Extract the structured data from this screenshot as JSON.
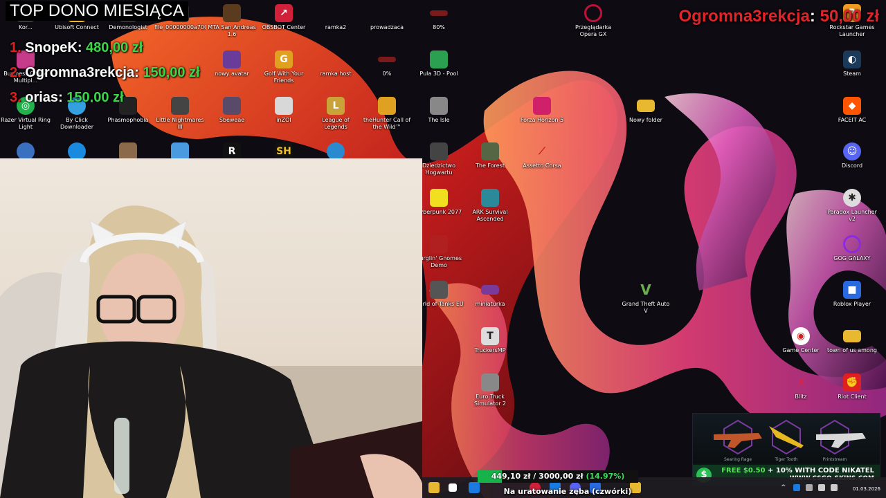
{
  "colors": {
    "accent_red": "#e0242a",
    "amount_green": "#3bd64a",
    "goal_green": "#16b24a"
  },
  "overlay": {
    "top_donors_title": "TOP DONO MIESIĄCA",
    "donors": [
      {
        "rank": "1.",
        "name": "SnopeK",
        "amount": "480,00 zł"
      },
      {
        "rank": "2.",
        "name": "Ogromna3rekcja",
        "amount": "150,00 zł"
      },
      {
        "rank": "3.",
        "name": "orias",
        "amount": "150,00 zł"
      }
    ],
    "top_donor": {
      "name": "Ogromna3rekcja",
      "separator": ":",
      "amount": "50,00 zł"
    }
  },
  "desktop_icons": [
    {
      "label": "Kor...",
      "icon": "app-icon",
      "color": "#3a3a3a"
    },
    {
      "label": "Ubisoft Connect",
      "icon": "folder-icon",
      "color": "#e8b930"
    },
    {
      "label": "Demonologist",
      "icon": "app-icon",
      "color": "#333"
    },
    {
      "label": "file_00000000a700...",
      "icon": "file-icon",
      "color": "#2a2a2a"
    },
    {
      "label": "MTA San Andreas 1.6",
      "icon": "game-icon",
      "color": "#5a3b1d"
    },
    {
      "label": "OBSBOT Center",
      "icon": "camera-icon",
      "color": "#d0203a"
    },
    {
      "label": "ramka2",
      "icon": "file-icon",
      "color": "#1c1c1c"
    },
    {
      "label": "prowadzaca",
      "icon": "file-icon",
      "color": "#1c1c1c"
    },
    {
      "label": "80%",
      "icon": "file-icon",
      "color": "#7a1a1a"
    },
    {
      "label": "Przeglądarka Opera GX",
      "icon": "opera-icon",
      "color": "#c0103a"
    },
    {
      "label": "Rockstar Games Launcher",
      "icon": "rockstar-icon",
      "color": "#f29b20"
    },
    {
      "label": "Business Online Multipl...",
      "icon": "game-icon",
      "color": "#c63b8a"
    },
    {
      "label": "By Click Downloader",
      "icon": "app-icon",
      "color": "#35a0e0"
    },
    {
      "label": "Phasmophobia",
      "icon": "game-icon",
      "color": "#222"
    },
    {
      "label": "Little Nightmares III",
      "icon": "game-icon",
      "color": "#444"
    },
    {
      "label": "nowy avatar",
      "icon": "file-icon",
      "color": "#6a3c9a"
    },
    {
      "label": "Golf With Your Friends",
      "icon": "game-icon",
      "color": "#e0a020"
    },
    {
      "label": "ramka host",
      "icon": "file-icon",
      "color": "#1c1c1c"
    },
    {
      "label": "0%",
      "icon": "file-icon",
      "color": "#7a1a1a"
    },
    {
      "label": "Pula 3D - Pool",
      "icon": "game-icon",
      "color": "#2aa050"
    },
    {
      "label": "Steam",
      "icon": "steam-icon",
      "color": "#1b3a5a"
    },
    {
      "label": "Razer Virtual Ring Light",
      "icon": "razer-icon",
      "color": "#22b14c"
    },
    {
      "label": "Sbeweae",
      "icon": "file-icon",
      "color": "#5a4a6a"
    },
    {
      "label": "inZOI",
      "icon": "game-icon",
      "color": "#d8d8d8"
    },
    {
      "label": "League of Legends",
      "icon": "lol-icon",
      "color": "#c9a23a"
    },
    {
      "label": "theHunter Call of the Wild™",
      "icon": "game-icon",
      "color": "#e0a020"
    },
    {
      "label": "The Isle",
      "icon": "game-icon",
      "color": "#888"
    },
    {
      "label": "Forza Horizon 5",
      "icon": "game-icon",
      "color": "#d0206a"
    },
    {
      "label": "Nowy folder",
      "icon": "folder-icon",
      "color": "#e8b930"
    },
    {
      "label": "FACEIT AC",
      "icon": "faceit-icon",
      "color": "#ff5500"
    },
    {
      "label": "Dziedzictwo Hogwartu",
      "icon": "game-icon",
      "color": "#444"
    },
    {
      "label": "The Forest",
      "icon": "game-icon",
      "color": "#556644"
    },
    {
      "label": "Assetto Corsa",
      "icon": "game-icon",
      "color": "#c02020"
    },
    {
      "label": "Discord",
      "icon": "discord-icon",
      "color": "#5865f2"
    },
    {
      "label": "Cyberpunk 2077",
      "icon": "game-icon",
      "color": "#f0e020"
    },
    {
      "label": "ARK Survival Ascended",
      "icon": "game-icon",
      "color": "#2a8a9a"
    },
    {
      "label": "Paradox Launcher v2",
      "icon": "app-icon",
      "color": "#ddd"
    },
    {
      "label": "Burglin' Gnomes Demo",
      "icon": "game-icon",
      "color": "#b02020"
    },
    {
      "label": "GOG GALAXY",
      "icon": "gog-icon",
      "color": "#8a2be2"
    },
    {
      "label": "World of Tanks EU",
      "icon": "game-icon",
      "color": "#555"
    },
    {
      "label": "miniaturka",
      "icon": "file-icon",
      "color": "#7a3a9a"
    },
    {
      "label": "Grand Theft Auto V",
      "icon": "gta-icon",
      "color": "#3a6a3a"
    },
    {
      "label": "Roblox Player",
      "icon": "roblox-icon",
      "color": "#2a6ae0"
    },
    {
      "label": "TruckersMP",
      "icon": "app-icon",
      "color": "#ddd"
    },
    {
      "label": "Game Center",
      "icon": "app-icon",
      "color": "#d02020"
    },
    {
      "label": "town of us among",
      "icon": "folder-icon",
      "color": "#e8b930"
    },
    {
      "label": "Euro Truck Simulator 2",
      "icon": "game-icon",
      "color": "#888"
    },
    {
      "label": "Blitz",
      "icon": "app-icon",
      "color": "#e02040"
    },
    {
      "label": "Riot Client",
      "icon": "riot-icon",
      "color": "#e02020"
    }
  ],
  "ad": {
    "skins": [
      "Searing Rage",
      "Tiger Tooth",
      "Printstream"
    ],
    "promo_highlight": "FREE $0.50",
    "promo_rest": " + 10% WITH CODE NIKATEL",
    "site": "WWW.CSGO-SKINS.COM"
  },
  "goal": {
    "current": "449,10 zł",
    "separator": "/",
    "target": "3000,00 zł",
    "percent_label": "(14.97%)",
    "fraction": 0.1497,
    "caption": "Na uratowanie zęba (czwórki)"
  },
  "taskbar": {
    "date": "01.03.2026"
  }
}
